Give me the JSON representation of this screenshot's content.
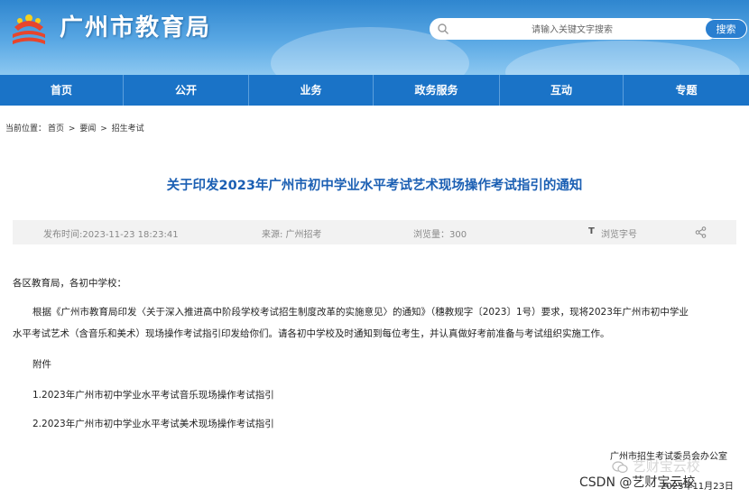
{
  "header": {
    "site_title": "广州市教育局",
    "search_placeholder": "请输入关键文字搜索",
    "search_button": "搜索"
  },
  "nav": {
    "items": [
      "首页",
      "公开",
      "业务",
      "政务服务",
      "互动",
      "专题"
    ]
  },
  "breadcrumb": {
    "prefix": "当前位置：",
    "items": [
      "首页",
      "要闻",
      "招生考试"
    ],
    "separator": ">"
  },
  "article": {
    "title": "关于印发2023年广州市初中学业水平考试艺术现场操作考试指引的通知",
    "meta": {
      "publish_time": "发布时间:2023-11-23 18:23:41",
      "source": "来源: 广州招考",
      "views": "浏览量：300",
      "font_size_toggle": "浏览字号",
      "font_size_toggle_icon": "T"
    },
    "salutation": "各区教育局，各初中学校：",
    "body_line1": "根据《广州市教育局印发〈关于深入推进高中阶段学校考试招生制度改革的实施意见〉的通知》（穗教规字〔2023〕1号）要求，现将2023年广州市初中学业",
    "body_line2": "水平考试艺术（含音乐和美术）现场操作考试指引印发给你们。请各初中学校及时通知到每位考生，并认真做好考前准备与考试组织实施工作。",
    "attachments_label": "附件",
    "attachments": [
      "1.2023年广州市初中学业水平考试音乐现场操作考试指引",
      "2.2023年广州市初中学业水平考试美术现场操作考试指引"
    ],
    "signature_org": "广州市招生考试委员会办公室",
    "signature_date": "2023年11月23日"
  },
  "watermarks": {
    "wechat": "艺财宝云校",
    "csdn": "CSDN @艺财宝云校"
  }
}
